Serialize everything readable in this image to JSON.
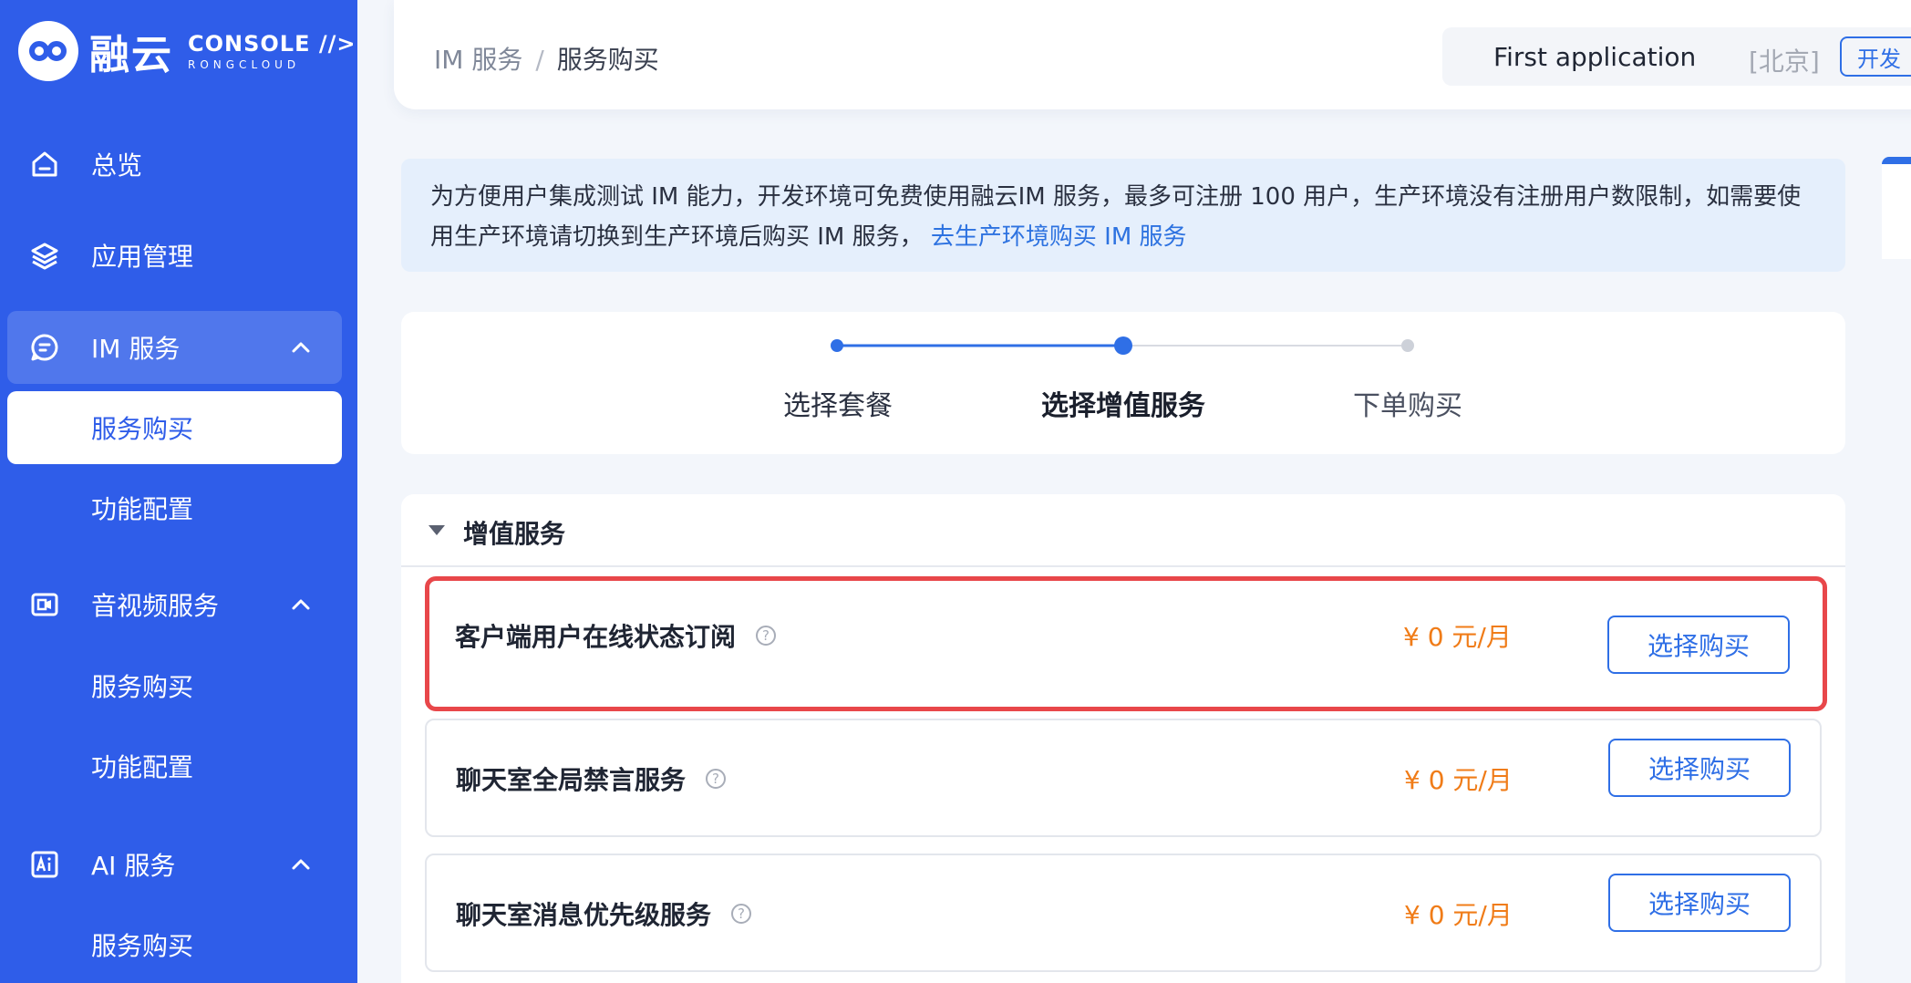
{
  "brand": {
    "name": "融云",
    "console": "CONSOLE //>",
    "sub": "RONGCLOUD"
  },
  "sidebar": {
    "items": [
      {
        "label": "总览",
        "icon": "home-icon"
      },
      {
        "label": "应用管理",
        "icon": "layers-icon"
      },
      {
        "label": "IM 服务",
        "icon": "chat-icon",
        "expanded": true,
        "children": [
          {
            "label": "服务购买",
            "active": true
          },
          {
            "label": "功能配置"
          }
        ]
      },
      {
        "label": "音视频服务",
        "icon": "video-icon",
        "expanded": true,
        "children": [
          {
            "label": "服务购买"
          },
          {
            "label": "功能配置"
          }
        ]
      },
      {
        "label": "AI 服务",
        "icon": "ai-icon",
        "expanded": true,
        "children": [
          {
            "label": "服务购买"
          }
        ]
      }
    ]
  },
  "header": {
    "breadcrumb": [
      "IM 服务",
      "服务购买"
    ],
    "separator": "/",
    "app_name": "First application",
    "region": "[北京]",
    "env": "开发"
  },
  "notice": {
    "text": "为方便用户集成测试 IM 能力，开发环境可免费使用融云IM 服务，最多可注册 100 用户，生产环境没有注册用户数限制，如需要使用生产环境请切换到生产环境后购买 IM 服务，",
    "link": "去生产环境购买 IM 服务"
  },
  "steps": {
    "items": [
      "选择套餐",
      "选择增值服务",
      "下单购买"
    ],
    "current_index": 1
  },
  "value_added": {
    "title": "增值服务",
    "help_glyph": "?",
    "services": [
      {
        "name": "客户端用户在线状态订阅",
        "price": "¥ 0 元/月",
        "button": "选择购买",
        "highlighted": true
      },
      {
        "name": "聊天室全局禁言服务",
        "price": "¥ 0 元/月",
        "button": "选择购买",
        "highlighted": false
      },
      {
        "name": "聊天室消息优先级服务",
        "price": "¥ 0 元/月",
        "button": "选择购买",
        "highlighted": false
      }
    ]
  },
  "colors": {
    "sidebar": "#2f5de9",
    "primary": "#2f6fe6",
    "price": "#f07c18",
    "highlight_border": "#e8474a"
  }
}
